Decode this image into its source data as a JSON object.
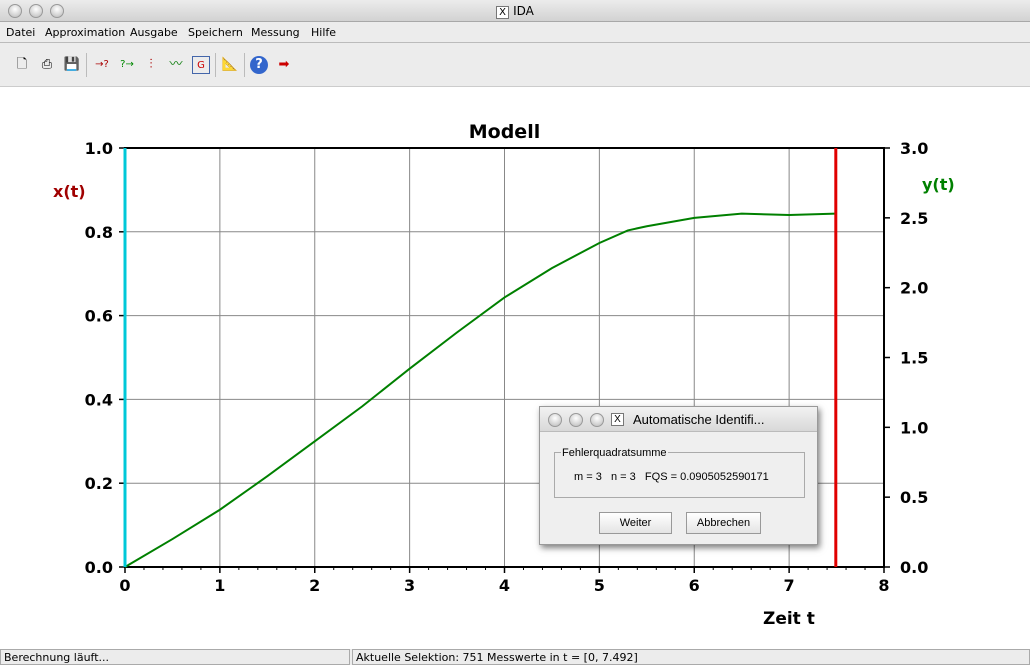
{
  "window": {
    "title": "IDA",
    "x_label": "X"
  },
  "menu": [
    "Datei",
    "Approximation",
    "Ausgabe",
    "Speichern",
    "Messung",
    "Hilfe"
  ],
  "toolbar": [
    {
      "icon": "new-file-icon",
      "glyph": "🗋"
    },
    {
      "icon": "print-icon",
      "glyph": "⎙"
    },
    {
      "icon": "save-icon",
      "glyph": "💾"
    },
    {
      "icon": "import-icon",
      "glyph": "→?"
    },
    {
      "icon": "export-icon",
      "glyph": "?→"
    },
    {
      "icon": "split-icon",
      "glyph": "⫶"
    },
    {
      "icon": "chart-icon",
      "glyph": "〰"
    },
    {
      "icon": "graphic-icon",
      "glyph": "G"
    },
    {
      "icon": "measure-icon",
      "glyph": "📐"
    },
    {
      "icon": "help-icon",
      "glyph": "?"
    },
    {
      "icon": "exit-icon",
      "glyph": "➡"
    }
  ],
  "chart_data": {
    "type": "line",
    "title": "Modell",
    "xlabel": "Zeit t",
    "ylabel_left": "x(t)",
    "ylabel_right": "y(t)",
    "xlim": [
      0,
      8
    ],
    "ylim_left": [
      0,
      1.0
    ],
    "ylim_right": [
      0,
      3.0
    ],
    "xticks": [
      "0",
      "1",
      "2",
      "3",
      "4",
      "5",
      "6",
      "7",
      "8"
    ],
    "yticks_left": [
      "0.0",
      "0.2",
      "0.4",
      "0.6",
      "0.8",
      "1.0"
    ],
    "yticks_right": [
      "0.0",
      "0.5",
      "1.0",
      "1.5",
      "2.0",
      "2.5",
      "3.0"
    ],
    "grid": true,
    "series": [
      {
        "name": "y(t)",
        "axis": "right",
        "color": "#008000",
        "x": [
          0,
          0.5,
          1,
          1.5,
          2,
          2.5,
          3,
          3.5,
          4,
          4.5,
          5,
          5.3,
          5.5,
          6,
          6.5,
          7,
          7.49
        ],
        "y": [
          0,
          0.2,
          0.41,
          0.65,
          0.9,
          1.15,
          1.42,
          1.68,
          1.93,
          2.14,
          2.32,
          2.41,
          2.44,
          2.5,
          2.53,
          2.52,
          2.53
        ]
      }
    ],
    "markers": [
      {
        "t": 0,
        "color": "#00c8d8"
      },
      {
        "t": 7.492,
        "color": "#e00000"
      }
    ]
  },
  "dialog": {
    "title": "Automatische Identifi...",
    "group_label": "Fehlerquadratsumme",
    "result": "m = 3   n = 3   FQS = 0.0905052590171",
    "ok": "Weiter",
    "cancel": "Abbrechen"
  },
  "status": {
    "left": "Berechnung läuft...",
    "right": "Aktuelle Selektion: 751 Messwerte in t = [0, 7.492]"
  }
}
